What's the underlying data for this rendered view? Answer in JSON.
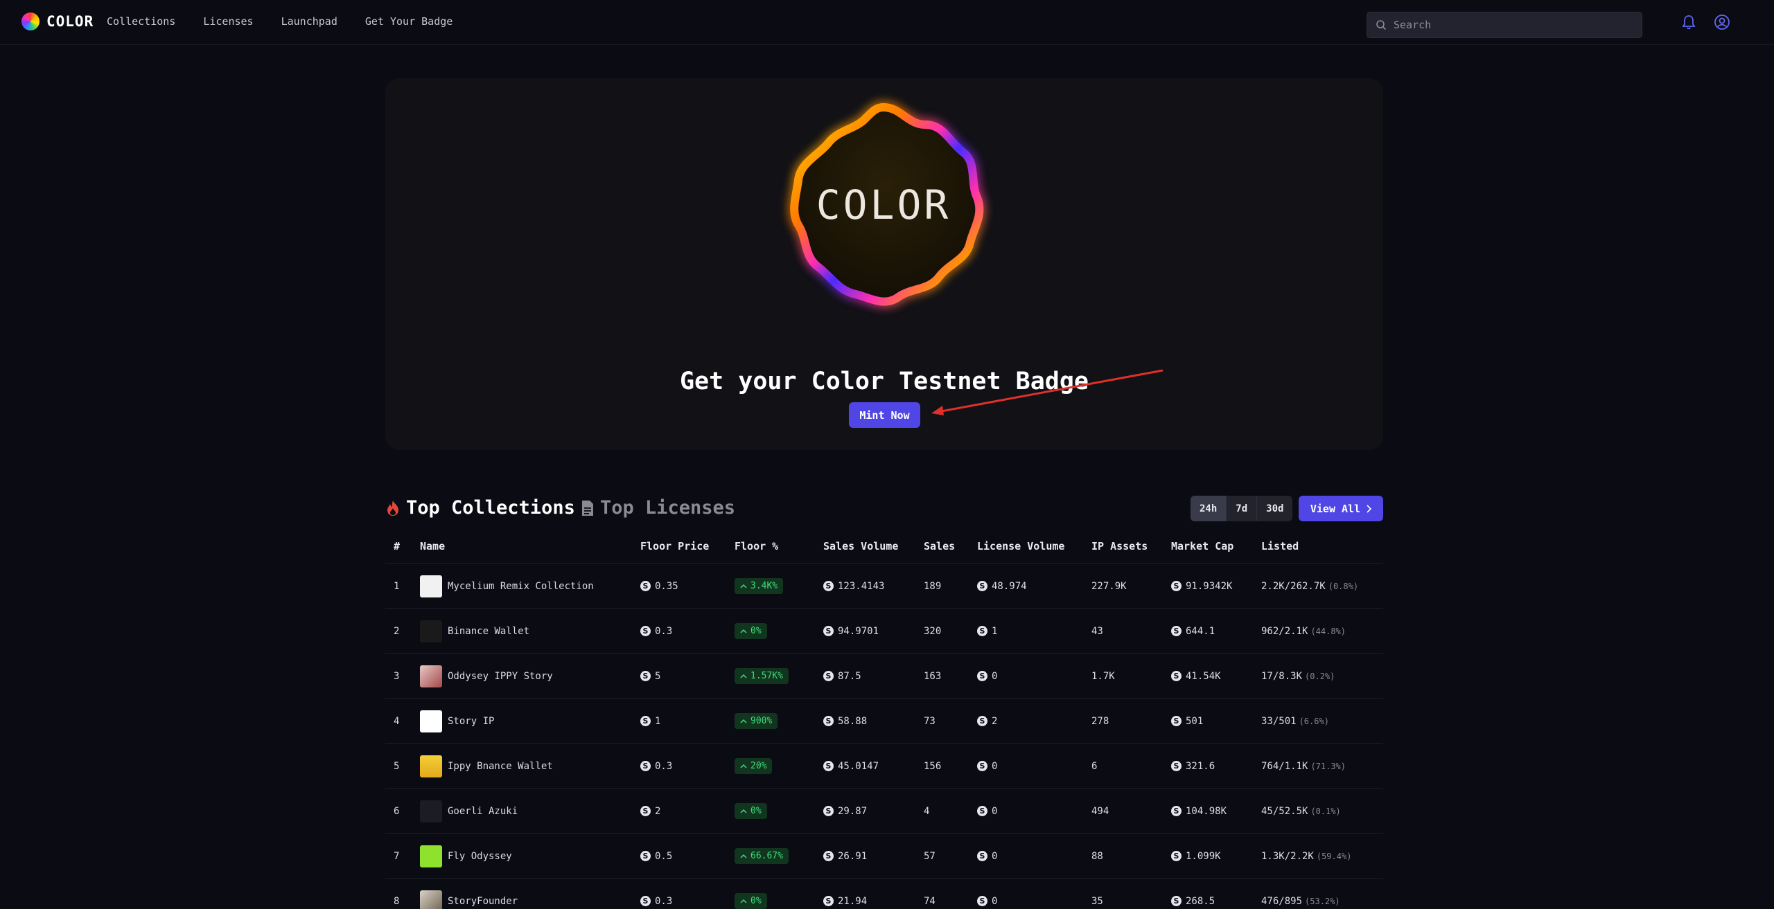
{
  "header": {
    "logo_text": "COLOR",
    "nav": [
      "Collections",
      "Licenses",
      "Launchpad",
      "Get Your Badge"
    ],
    "search_placeholder": "Search"
  },
  "hero": {
    "badge_text": "COLOR",
    "title": "Get your Color Testnet Badge",
    "mint_label": "Mint Now"
  },
  "section": {
    "tab_collections": "Top Collections",
    "tab_licenses": "Top Licenses",
    "ranges": [
      "24h",
      "7d",
      "30d"
    ],
    "active_range": "24h",
    "view_all": "View All"
  },
  "table": {
    "headers": [
      "#",
      "Name",
      "Floor Price",
      "Floor %",
      "Sales Volume",
      "Sales",
      "License Volume",
      "IP Assets",
      "Market Cap",
      "Listed"
    ],
    "rows": [
      {
        "rank": "1",
        "name": "Mycelium Remix Collection",
        "floor": "0.35",
        "floor_pct": "3.4K%",
        "volume": "123.4143",
        "sales": "189",
        "license_volume": "48.974",
        "ip_assets": "227.9K",
        "market_cap": "91.9342K",
        "listed": "2.2K/262.7K",
        "listed_pct": "(0.8%)"
      },
      {
        "rank": "2",
        "name": "Binance Wallet",
        "floor": "0.3",
        "floor_pct": "0%",
        "volume": "94.9701",
        "sales": "320",
        "license_volume": "1",
        "ip_assets": "43",
        "market_cap": "644.1",
        "listed": "962/2.1K",
        "listed_pct": "(44.8%)"
      },
      {
        "rank": "3",
        "name": "Oddysey IPPY Story",
        "floor": "5",
        "floor_pct": "1.57K%",
        "volume": "87.5",
        "sales": "163",
        "license_volume": "0",
        "ip_assets": "1.7K",
        "market_cap": "41.54K",
        "listed": "17/8.3K",
        "listed_pct": "(0.2%)"
      },
      {
        "rank": "4",
        "name": "Story IP",
        "floor": "1",
        "floor_pct": "900%",
        "volume": "58.88",
        "sales": "73",
        "license_volume": "2",
        "ip_assets": "278",
        "market_cap": "501",
        "listed": "33/501",
        "listed_pct": "(6.6%)"
      },
      {
        "rank": "5",
        "name": "Ippy Bnance Wallet",
        "floor": "0.3",
        "floor_pct": "20%",
        "volume": "45.0147",
        "sales": "156",
        "license_volume": "0",
        "ip_assets": "6",
        "market_cap": "321.6",
        "listed": "764/1.1K",
        "listed_pct": "(71.3%)"
      },
      {
        "rank": "6",
        "name": "Goerli Azuki",
        "floor": "2",
        "floor_pct": "0%",
        "volume": "29.87",
        "sales": "4",
        "license_volume": "0",
        "ip_assets": "494",
        "market_cap": "104.98K",
        "listed": "45/52.5K",
        "listed_pct": "(0.1%)"
      },
      {
        "rank": "7",
        "name": "Fly Odyssey",
        "floor": "0.5",
        "floor_pct": "66.67%",
        "volume": "26.91",
        "sales": "57",
        "license_volume": "0",
        "ip_assets": "88",
        "market_cap": "1.099K",
        "listed": "1.3K/2.2K",
        "listed_pct": "(59.4%)"
      },
      {
        "rank": "8",
        "name": "StoryFounder",
        "floor": "0.3",
        "floor_pct": "0%",
        "volume": "21.94",
        "sales": "74",
        "license_volume": "0",
        "ip_assets": "35",
        "market_cap": "268.5",
        "listed": "476/895",
        "listed_pct": "(53.2%)"
      }
    ]
  },
  "colors": {
    "accent": "#4f46e5",
    "positive": "#3fdc7a",
    "background": "#0b0b13",
    "panel": "#111116"
  }
}
